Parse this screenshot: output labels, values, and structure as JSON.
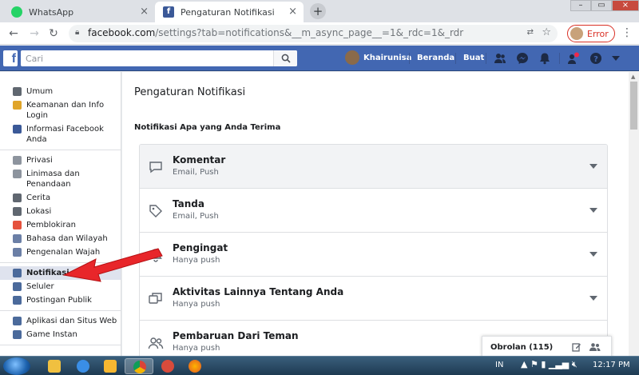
{
  "browser": {
    "tabs": [
      {
        "title": "WhatsApp"
      },
      {
        "title": "Pengaturan Notifikasi"
      }
    ],
    "url_host": "facebook.com",
    "url_path": "/settings?tab=notifications&__m_async_page__=1&_rdc=1&_rdr",
    "error_label": "Error"
  },
  "fb_header": {
    "logo": "f",
    "search_placeholder": "Cari",
    "user_name": "Khairunisa",
    "home_link": "Beranda",
    "create_link": "Buat"
  },
  "sidebar": {
    "groups": [
      [
        {
          "label": "Umum",
          "icon": "gears-icon",
          "color": "#606770"
        },
        {
          "label": "Keamanan dan Info Login",
          "icon": "shield-icon",
          "color": "#e0a52a"
        },
        {
          "label": "Informasi Facebook Anda",
          "icon": "facebook-icon",
          "color": "#3b5998"
        }
      ],
      [
        {
          "label": "Privasi",
          "icon": "lock-icon",
          "color": "#8d949e"
        },
        {
          "label": "Linimasa dan Penandaan",
          "icon": "timeline-icon",
          "color": "#8d949e"
        },
        {
          "label": "Cerita",
          "icon": "book-icon",
          "color": "#606770"
        },
        {
          "label": "Lokasi",
          "icon": "location-icon",
          "color": "#606770"
        },
        {
          "label": "Pemblokiran",
          "icon": "block-icon",
          "color": "#e5523d"
        },
        {
          "label": "Bahasa dan Wilayah",
          "icon": "language-icon",
          "color": "#6b7fa6"
        },
        {
          "label": "Pengenalan Wajah",
          "icon": "face-icon",
          "color": "#6b7fa6"
        }
      ],
      [
        {
          "label": "Notifikasi",
          "icon": "globe-icon",
          "color": "#4b6a9b"
        },
        {
          "label": "Seluler",
          "icon": "mobile-icon",
          "color": "#4b6a9b"
        },
        {
          "label": "Postingan Publik",
          "icon": "rss-icon",
          "color": "#4b6a9b"
        }
      ],
      [
        {
          "label": "Aplikasi dan Situs Web",
          "icon": "apps-icon",
          "color": "#4b6a9b"
        },
        {
          "label": "Game Instan",
          "icon": "game-icon",
          "color": "#4b6a9b"
        }
      ]
    ]
  },
  "main": {
    "title": "Pengaturan Notifikasi",
    "section_title": "Notifikasi Apa yang Anda Terima",
    "rows": [
      {
        "title": "Komentar",
        "subtitle": "Email, Push",
        "icon": "comment-icon"
      },
      {
        "title": "Tanda",
        "subtitle": "Email, Push",
        "icon": "tag-icon"
      },
      {
        "title": "Pengingat",
        "subtitle": "Hanya push",
        "icon": "bell-icon"
      },
      {
        "title": "Aktivitas Lainnya Tentang Anda",
        "subtitle": "Hanya push",
        "icon": "activity-icon"
      },
      {
        "title": "Pembaruan Dari Teman",
        "subtitle": "Hanya push",
        "icon": "friends-icon"
      }
    ]
  },
  "chat": {
    "label": "Obrolan (115)"
  },
  "taskbar": {
    "lang": "IN",
    "time": "12:17 PM"
  },
  "colors": {
    "fb_blue": "#4267b2",
    "arrow_red": "#e8262a",
    "active_nav": "#dfe3ee"
  }
}
